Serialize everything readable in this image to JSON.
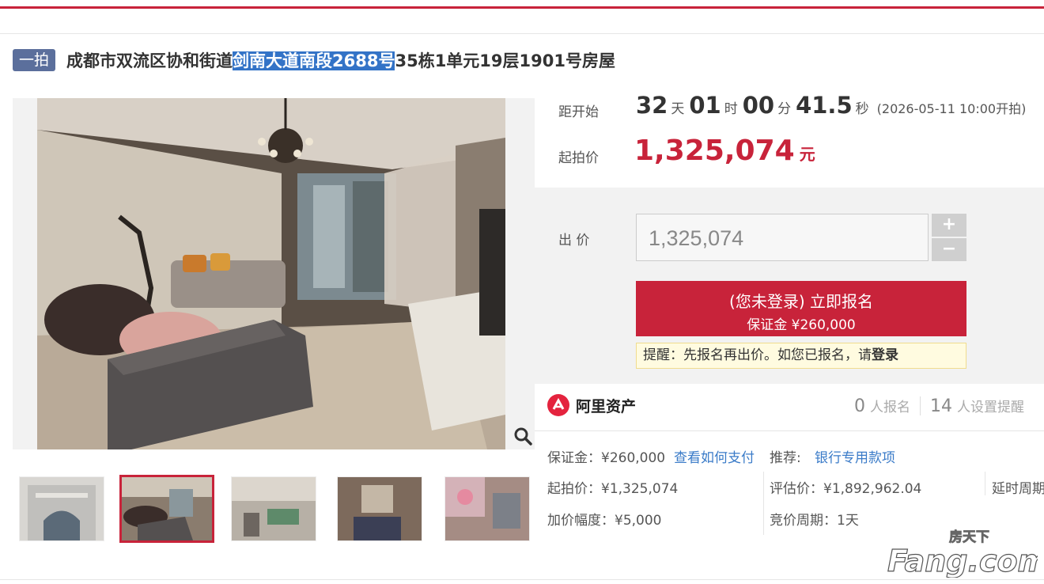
{
  "listing": {
    "badge": "一拍",
    "title_before": "成都市双流区协和街道",
    "title_highlight": "剑南大道南段2688号",
    "title_after": "35栋1单元19层1901号房屋"
  },
  "countdown": {
    "label": "距开始",
    "days": "32",
    "days_unit": "天",
    "hours": "01",
    "hours_unit": "时",
    "minutes": "00",
    "minutes_unit": "分",
    "seconds": "41.5",
    "seconds_unit": "秒",
    "start_text": "(2026-05-11 10:00开拍)"
  },
  "starting_price": {
    "label": "起拍价",
    "value": "1,325,074",
    "unit": "元"
  },
  "bid": {
    "label": "出 价",
    "value": "1,325,074",
    "plus": "+",
    "minus": "−"
  },
  "register_button": {
    "line1": "(您未登录) 立即报名",
    "line2": "保证金 ¥260,000"
  },
  "notice": {
    "text": "提醒：先报名再出价。如您已报名，请",
    "link": "登录"
  },
  "ali": {
    "brand": "阿里资产"
  },
  "stats": {
    "registered_count": "0",
    "registered_label": "人报名",
    "reminder_count": "14",
    "reminder_label": "人设置提醒"
  },
  "details": {
    "deposit": "保证金：¥260,000",
    "how_to_pay": "查看如何支付",
    "recommend_label": "推荐:",
    "recommend_link": "银行专用款项",
    "start_price": "起拍价：¥1,325,074",
    "appraisal": "评估价：¥1,892,962.04",
    "delay": "延时周期",
    "increment": "加价幅度：¥5,000",
    "cycle": "竞价周期：1天"
  },
  "watermark": {
    "line1": "房天下",
    "line2": "Fang.com"
  },
  "colors": {
    "accent": "#c8233a",
    "badge": "#5b6f9c",
    "link": "#3a7bc8",
    "highlight": "#3373c7"
  }
}
